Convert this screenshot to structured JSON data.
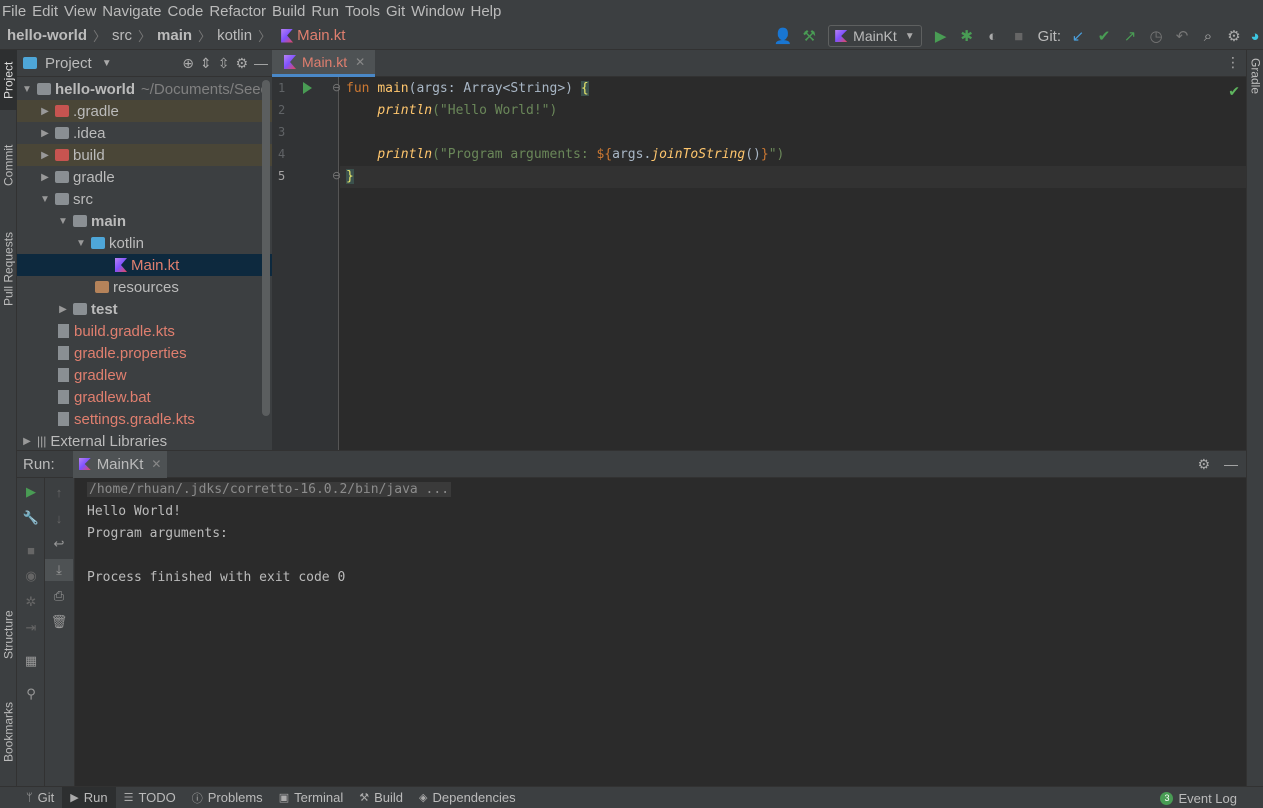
{
  "menu": [
    "File",
    "Edit",
    "View",
    "Navigate",
    "Code",
    "Refactor",
    "Build",
    "Run",
    "Tools",
    "Git",
    "Window",
    "Help"
  ],
  "breadcrumb": {
    "project": "hello-world",
    "items": [
      "src",
      "main",
      "kotlin",
      "Main.kt"
    ]
  },
  "toolbar": {
    "run_config": "MainKt",
    "git_label": "Git:"
  },
  "left_tabs": [
    "Project",
    "Commit",
    "Pull Requests",
    "Structure",
    "Bookmarks"
  ],
  "right_tabs": [
    "Gradle"
  ],
  "project_panel": {
    "title": "Project",
    "root": "hello-world",
    "root_path": "~/Documents/Seed",
    "tree": [
      {
        "label": ".gradle",
        "depth": 1
      },
      {
        "label": ".idea",
        "depth": 1
      },
      {
        "label": "build",
        "depth": 1
      },
      {
        "label": "gradle",
        "depth": 1
      },
      {
        "label": "src",
        "depth": 1
      },
      {
        "label": "main",
        "depth": 2
      },
      {
        "label": "kotlin",
        "depth": 3
      },
      {
        "label": "Main.kt",
        "depth": 4
      },
      {
        "label": "resources",
        "depth": 3
      },
      {
        "label": "test",
        "depth": 2
      },
      {
        "label": "build.gradle.kts",
        "depth": 1
      },
      {
        "label": "gradle.properties",
        "depth": 1
      },
      {
        "label": "gradlew",
        "depth": 1
      },
      {
        "label": "gradlew.bat",
        "depth": 1
      },
      {
        "label": "settings.gradle.kts",
        "depth": 1
      },
      {
        "label": "External Libraries",
        "depth": 0
      }
    ]
  },
  "editor": {
    "tab": "Main.kt",
    "line_numbers": [
      "1",
      "2",
      "3",
      "4",
      "5"
    ],
    "code": {
      "l1_kw": "fun ",
      "l1_fn": "main",
      "l1_rest": "(args: Array<String>) ",
      "l1_brace": "{",
      "l2_indent": "    ",
      "l2_fn": "println",
      "l2_str": "(\"Hello World!\")",
      "l4_indent": "    ",
      "l4_fn": "println",
      "l4_str1": "(\"Program arguments: ",
      "l4_tpl": "${",
      "l4_id": "args.",
      "l4_call": "joinToString",
      "l4_paren": "()",
      "l4_tplend": "}",
      "l4_str2": "\")",
      "l5_brace": "}"
    }
  },
  "run_panel": {
    "label": "Run:",
    "tab": "MainKt",
    "console": [
      "/home/rhuan/.jdks/corretto-16.0.2/bin/java ...",
      "Hello World!",
      "Program arguments: ",
      "",
      "Process finished with exit code 0"
    ]
  },
  "bottom_tabs": [
    "Git",
    "Run",
    "TODO",
    "Problems",
    "Terminal",
    "Build",
    "Dependencies"
  ],
  "event_log": {
    "label": "Event Log",
    "count": "3"
  }
}
